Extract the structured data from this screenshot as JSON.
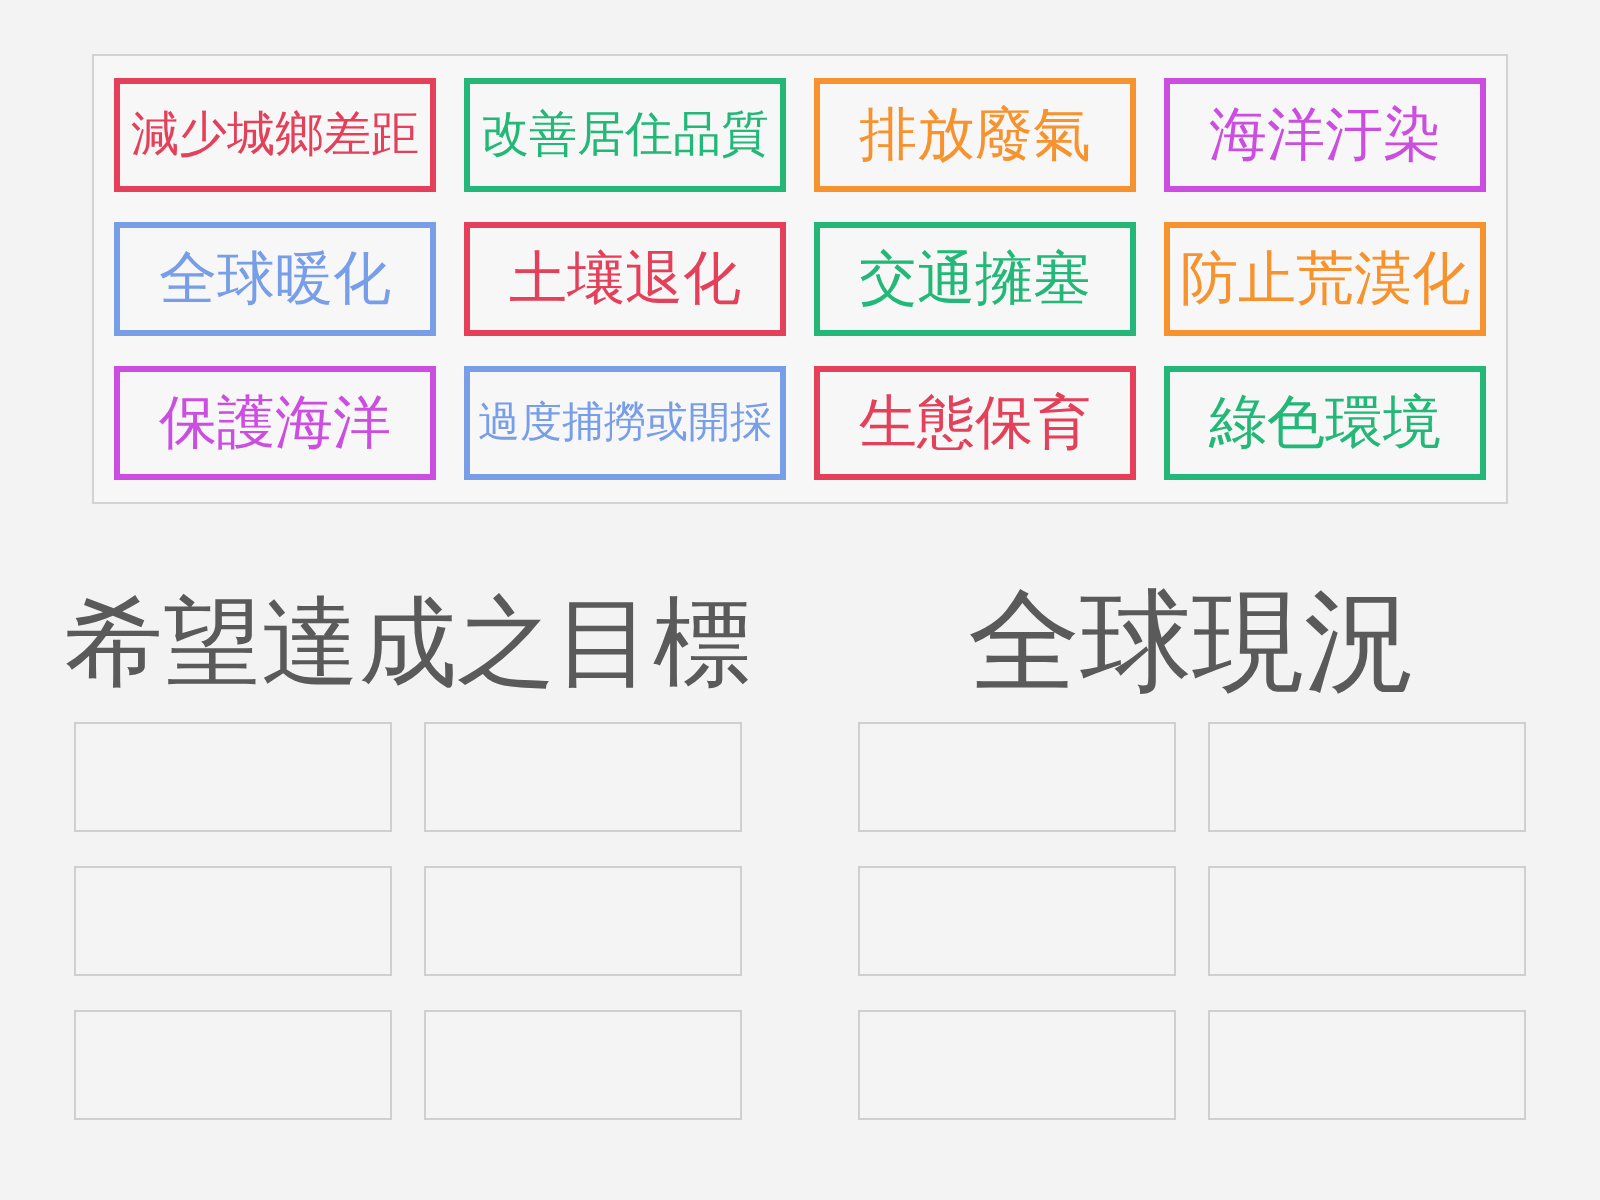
{
  "card_bank": {
    "cards": [
      {
        "text": "減少城鄉差距",
        "color": "#e4405a"
      },
      {
        "text": "改善居住品質",
        "color": "#23b878"
      },
      {
        "text": "排放廢氣",
        "color": "#f7932f"
      },
      {
        "text": "海洋汙染",
        "color": "#cc4ee0"
      },
      {
        "text": "全球暖化",
        "color": "#789ee8"
      },
      {
        "text": "土壤退化",
        "color": "#e4405a"
      },
      {
        "text": "交通擁塞",
        "color": "#23b878"
      },
      {
        "text": "防止荒漠化",
        "color": "#f7932f"
      },
      {
        "text": "保護海洋",
        "color": "#cc4ee0"
      },
      {
        "text": "過度捕撈或開採",
        "color": "#789ee8"
      },
      {
        "text": "生態保育",
        "color": "#e4405a"
      },
      {
        "text": "綠色環境",
        "color": "#23b878"
      }
    ]
  },
  "groups": [
    {
      "title": "希望達成之目標",
      "slots": [
        {
          "kind": "empty"
        },
        {
          "kind": "empty"
        },
        {
          "kind": "empty"
        },
        {
          "kind": "empty"
        },
        {
          "kind": "empty"
        },
        {
          "kind": "empty"
        }
      ]
    },
    {
      "title": "全球現況",
      "slots": [
        {
          "kind": "empty"
        },
        {
          "kind": "empty"
        },
        {
          "kind": "empty"
        },
        {
          "kind": "empty"
        },
        {
          "kind": "empty"
        },
        {
          "kind": "empty"
        }
      ]
    }
  ]
}
